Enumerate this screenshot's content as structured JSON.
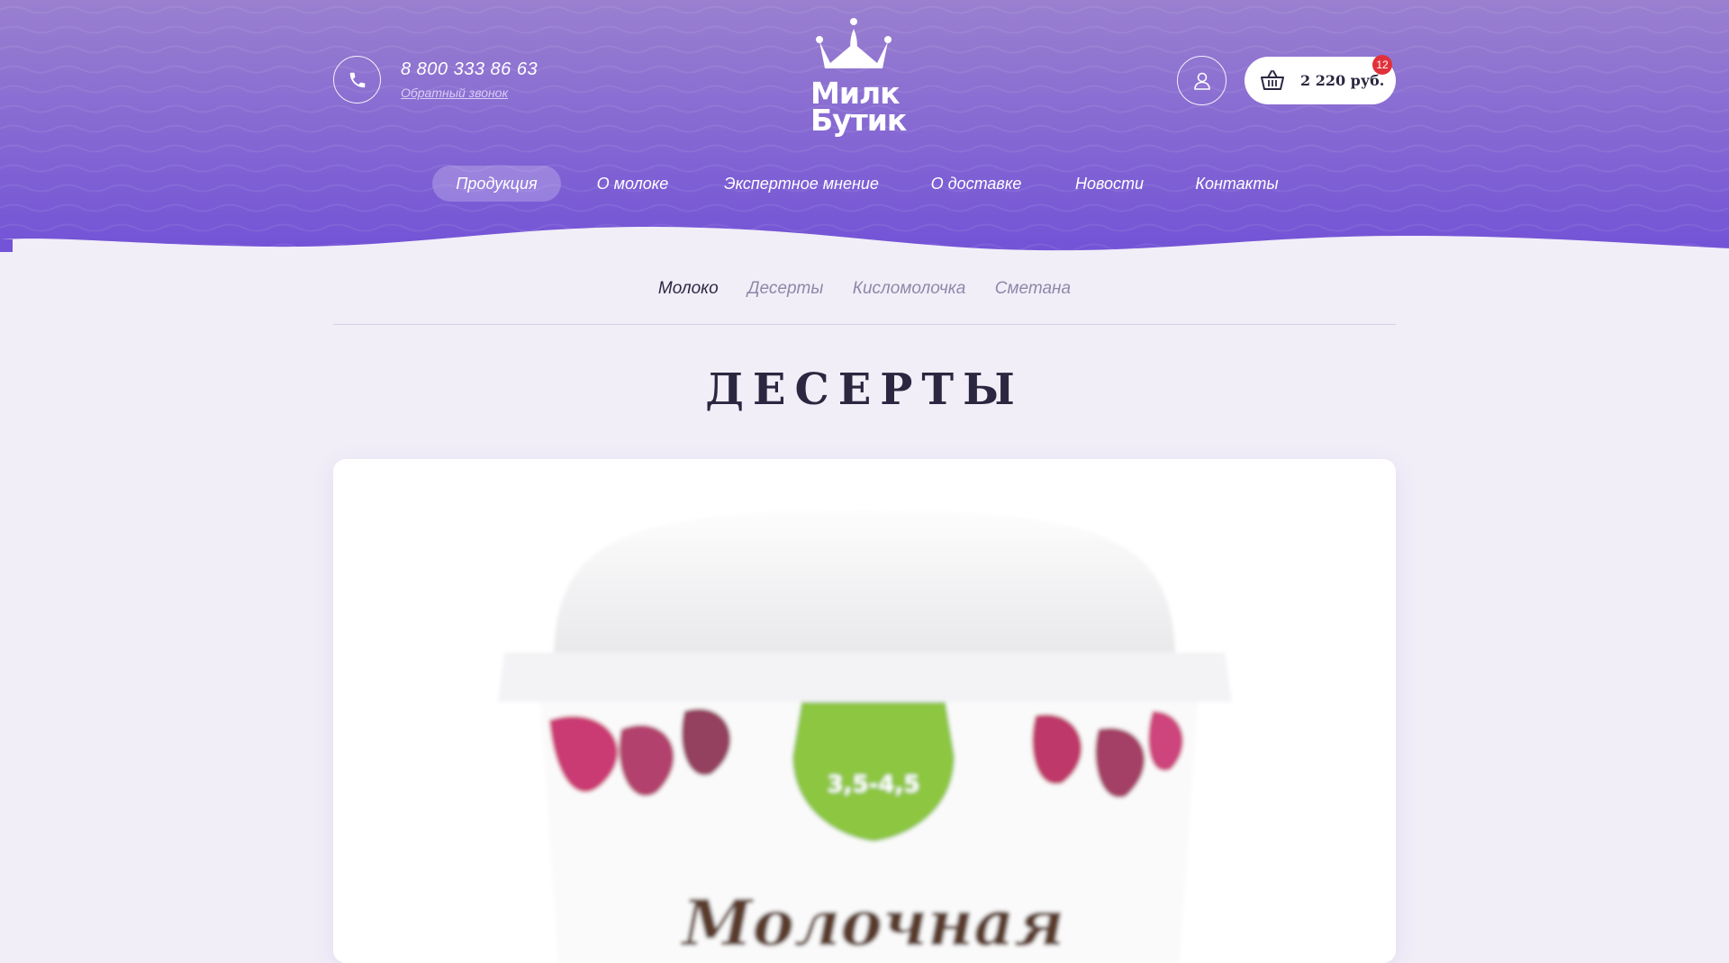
{
  "header": {
    "phone": "8 800 333 86 63",
    "callback_label": "Обратный звонок",
    "logo_line1": "Милк",
    "logo_line2": "Бутик",
    "cart_total": "2 220 руб.",
    "cart_count": "12"
  },
  "nav": [
    {
      "label": "Продукция",
      "active": true
    },
    {
      "label": "О молоке"
    },
    {
      "label": "Экспертное мнение"
    },
    {
      "label": "О доставке"
    },
    {
      "label": "Новости"
    },
    {
      "label": "Контакты"
    }
  ],
  "subnav": [
    {
      "label": "Молоко",
      "active": true
    },
    {
      "label": "Десерты"
    },
    {
      "label": "Кисломолочка"
    },
    {
      "label": "Сметана"
    }
  ],
  "page_title": "ДЕСЕРТЫ",
  "product": {
    "badge_text": "3,5-4,5",
    "brand_text": "Молочная"
  },
  "icons": {
    "phone": "phone-icon",
    "user": "user-icon",
    "cart": "basket-icon",
    "logo": "crown-icon"
  },
  "colors": {
    "header_top": "#9b7fd0",
    "header_bottom": "#6f4fd8",
    "page_bg": "#f1eef8",
    "badge": "#e0313a",
    "title": "#2c2740"
  }
}
